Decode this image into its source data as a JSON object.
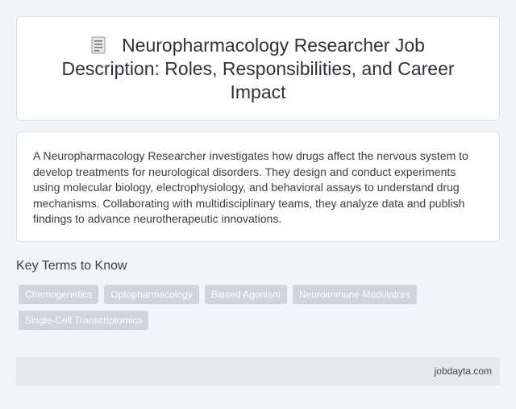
{
  "header": {
    "icon": "document-icon",
    "title": "Neuropharmacology Researcher Job Description: Roles, Responsibilities, and Career Impact"
  },
  "description": "A Neuropharmacology Researcher investigates how drugs affect the nervous system to develop treatments for neurological disorders. They design and conduct experiments using molecular biology, electrophysiology, and behavioral assays to understand drug mechanisms. Collaborating with multidisciplinary teams, they analyze data and publish findings to advance neurotherapeutic innovations.",
  "key_terms": {
    "heading": "Key Terms to Know",
    "items": [
      "Chemogenetics",
      "Optopharmacology",
      "Biased Agonism",
      "Neuroimmune Modulators",
      "Single-Cell Transcriptomics"
    ]
  },
  "footer": {
    "site": "jobdayta.com"
  },
  "colors": {
    "background": "#f1f4f8",
    "card": "#ffffff",
    "tag": "#cfd4da",
    "footer": "#e4e9ee"
  }
}
